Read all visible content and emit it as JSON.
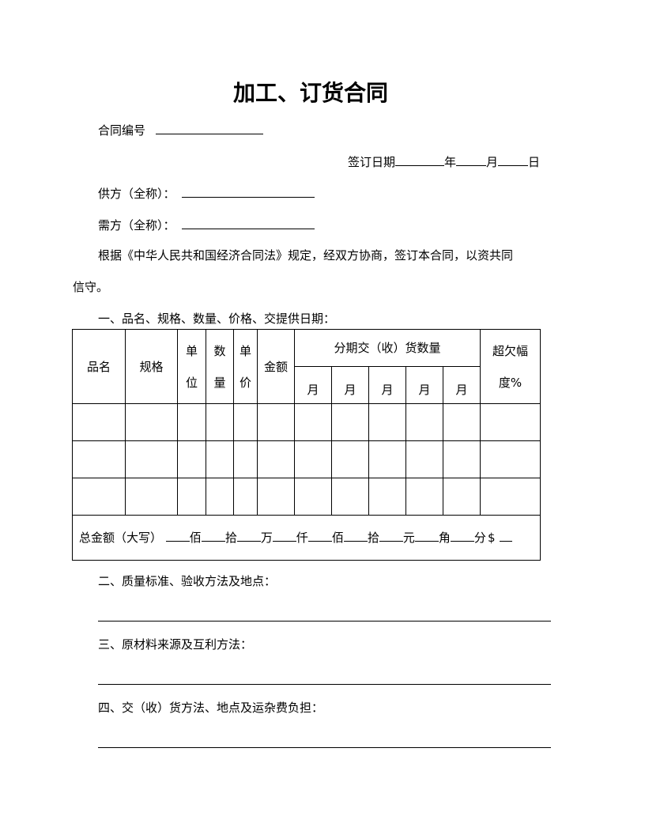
{
  "title": "加工、订货合同",
  "contract_no": {
    "label": "合同编号"
  },
  "sign_date": {
    "label": "签订日期",
    "year": "年",
    "month": "月",
    "day": "日"
  },
  "supplier": {
    "label": "供方（全称）："
  },
  "buyer": {
    "label": "需方（全称）："
  },
  "preamble": {
    "line1": "根据《中华人民共和国经济合同法》规定，经双方协商，签订本合同，以资共同",
    "line2": "信守。"
  },
  "section1": {
    "heading": "一、品名、规格、数量、价格、交提供日期："
  },
  "table": {
    "headers": {
      "name": "品名",
      "spec": "规格",
      "unit": [
        "单",
        "位"
      ],
      "qty": [
        "数",
        "量"
      ],
      "price": [
        "单",
        "价"
      ],
      "amount": "金额",
      "installments": "分期交（收）货数量",
      "months": [
        "月",
        "月",
        "月",
        "月",
        "月"
      ],
      "overshort": [
        "超欠幅",
        "度%"
      ]
    },
    "rows": [
      [
        "",
        "",
        "",
        "",
        "",
        "",
        "",
        "",
        "",
        "",
        "",
        ""
      ],
      [
        "",
        "",
        "",
        "",
        "",
        "",
        "",
        "",
        "",
        "",
        "",
        ""
      ],
      [
        "",
        "",
        "",
        "",
        "",
        "",
        "",
        "",
        "",
        "",
        "",
        ""
      ]
    ],
    "total": {
      "label": "总金额（大写）",
      "units": [
        "佰",
        "拾",
        "万",
        "仟",
        "佰",
        "拾",
        "元",
        "角",
        "分"
      ],
      "currency": "$"
    }
  },
  "section2": {
    "heading": "二、质量标准、验收方法及地点："
  },
  "section3": {
    "heading": "三、原材料来源及互利方法："
  },
  "section4": {
    "heading": "四、交（收）货方法、地点及运杂费负担："
  }
}
